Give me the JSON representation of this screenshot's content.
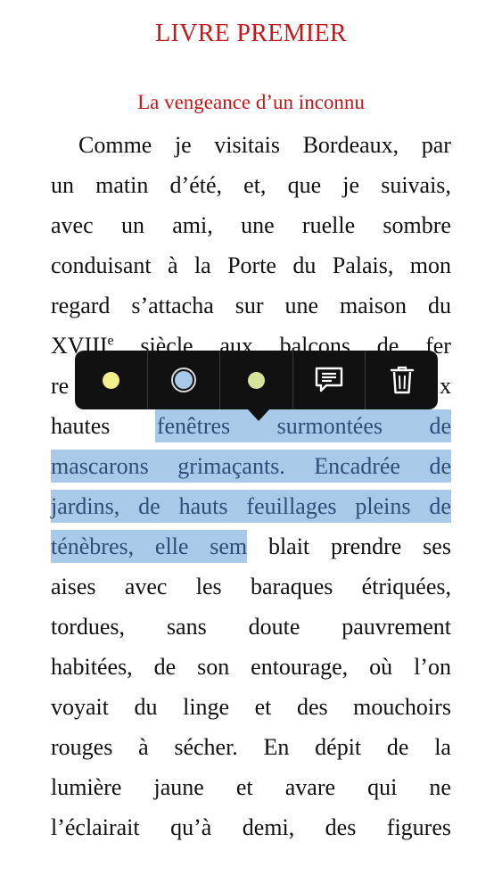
{
  "book": {
    "chapter_title": "LIVRE PREMIER",
    "chapter_subtitle": "La vengeance d’un inconnu"
  },
  "lines": [
    {
      "indent": true,
      "words": [
        "Comme",
        "je",
        "visitais",
        "Bordeaux,",
        "par"
      ]
    },
    {
      "indent": false,
      "words": [
        "un",
        "matin",
        "d’été,",
        "et,",
        "que",
        "je",
        "suivais,"
      ]
    },
    {
      "indent": false,
      "words": [
        "avec",
        "un",
        "ami,",
        "une",
        "ruelle",
        "sombre"
      ]
    },
    {
      "indent": false,
      "words": [
        "conduisant",
        "à",
        "la",
        "Porte",
        "du",
        "Palais,",
        "mon"
      ]
    },
    {
      "indent": false,
      "words": [
        "regard",
        "s’attacha",
        "sur",
        "une",
        "maison",
        "du"
      ]
    },
    {
      "indent": false,
      "words": [
        "XVIII",
        "siècle",
        "aux",
        "balcons",
        "de",
        "fer"
      ],
      "sup": "e"
    },
    {
      "indent": false,
      "words": [
        "re",
        "x"
      ],
      "hidden": true
    },
    {
      "indent": false,
      "words": [
        "hautes",
        "fenêtres",
        "surmontées",
        "de"
      ],
      "highlight_from": 1
    },
    {
      "indent": false,
      "words": [
        "mascarons",
        "grimaçants.",
        "Encadrée",
        "de"
      ],
      "highlight_from": 0
    },
    {
      "indent": false,
      "words": [
        "jardins,",
        "de",
        "hauts",
        "feuillages",
        "pleins",
        "de"
      ],
      "highlight_from": 0
    },
    {
      "indent": false,
      "words": [
        "ténèbres,",
        "elle",
        "sem",
        "blait",
        "prendre",
        "ses"
      ],
      "highlight_until": 3
    },
    {
      "indent": false,
      "words": [
        "aises",
        "avec",
        "les",
        "baraques",
        "étriquées,"
      ]
    },
    {
      "indent": false,
      "words": [
        "tordues,",
        "sans",
        "doute",
        "pauvrement"
      ]
    },
    {
      "indent": false,
      "words": [
        "habitées,",
        "de",
        "son",
        "entourage,",
        "où",
        "l’on"
      ]
    },
    {
      "indent": false,
      "words": [
        "voyait",
        "du",
        "linge",
        "et",
        "des",
        "mouchoirs"
      ]
    },
    {
      "indent": false,
      "words": [
        "rouges",
        "à",
        "sécher.",
        "En",
        "dépit",
        "de",
        "la"
      ]
    },
    {
      "indent": false,
      "words": [
        "lumière",
        "jaune",
        "et",
        "avare",
        "qui",
        "ne"
      ]
    },
    {
      "indent": false,
      "words": [
        "l’éclairait",
        "qu’à",
        "demi,",
        "des",
        "figures"
      ]
    }
  ],
  "toolbar": {
    "tools": [
      {
        "name": "highlight-yellow-button",
        "icon": "yellow-dot-icon",
        "color": "#f4ef8a"
      },
      {
        "name": "highlight-blue-button",
        "icon": "blue-dot-selected-icon",
        "color": "#a9c9e8"
      },
      {
        "name": "highlight-green-button",
        "icon": "green-dot-icon",
        "color": "#d6e39a"
      },
      {
        "name": "add-note-button",
        "icon": "note-icon"
      },
      {
        "name": "delete-highlight-button",
        "icon": "trash-icon"
      }
    ]
  },
  "colors": {
    "accent": "#c3181c",
    "highlight": "#a9c9e8",
    "highlight_text": "#2e4f75",
    "toolbar_bg": "#111111"
  }
}
